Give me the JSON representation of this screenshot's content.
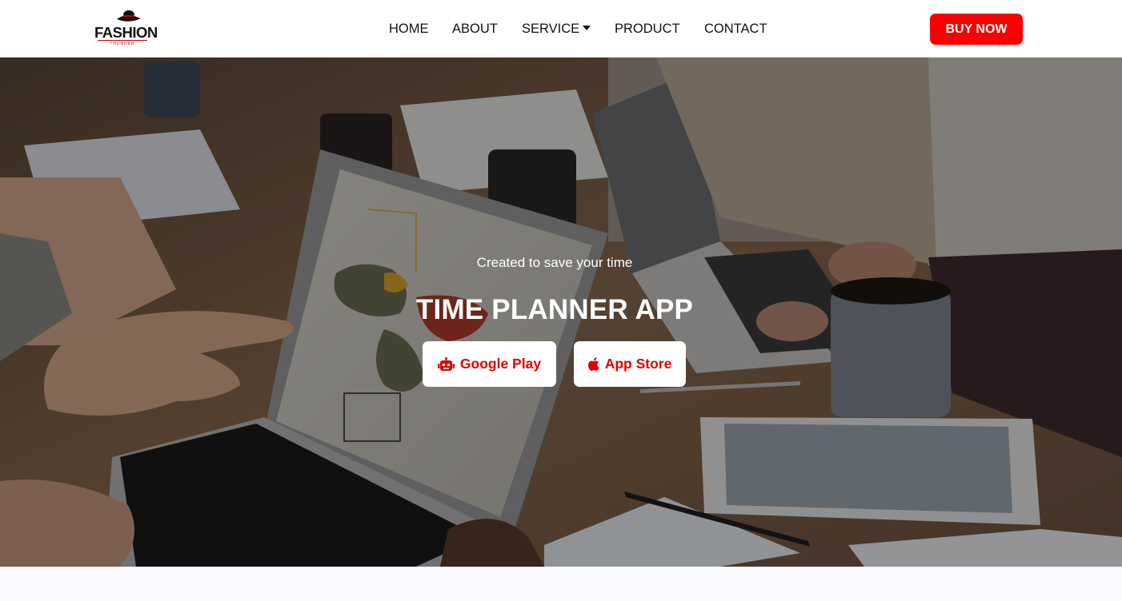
{
  "brand": {
    "name": "FASHION",
    "tagline": "THUNDER"
  },
  "nav": {
    "home": "HOME",
    "about": "ABOUT",
    "service": "SERVICE",
    "product": "PRODUCT",
    "contact": "CONTACT"
  },
  "header": {
    "buy_label": "BUY NOW"
  },
  "hero": {
    "subtitle": "Created to save your time",
    "title": "TIME PLANNER APP",
    "google_play_label": "Google Play",
    "app_store_label": "App Store",
    "background_icon": "business-meeting-photo"
  },
  "colors": {
    "accent": "#fb0000",
    "button_text": "#e00000",
    "header_bg": "#ffffff"
  }
}
